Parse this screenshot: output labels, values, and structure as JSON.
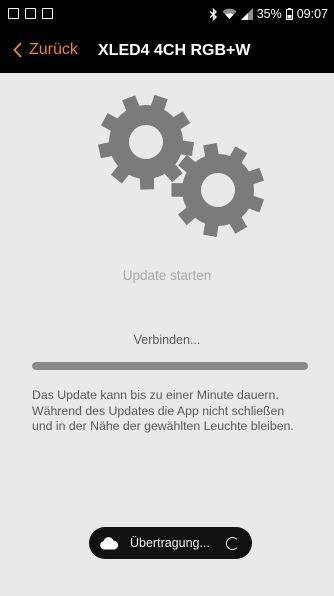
{
  "status_bar": {
    "battery": "35%",
    "time": "09:07"
  },
  "header": {
    "back_label": "Zurück",
    "title": "XLED4 4CH RGB+W"
  },
  "main": {
    "update_title": "Update starten",
    "status_text": "Verbinden...",
    "progress_fraction": 1.0,
    "info_lines": [
      "Das Update kann bis zu einer Minute dauern.",
      "Während des Updates die App nicht schließen",
      "und in der Nähe der gewählten Leuchte bleiben."
    ]
  },
  "toast": {
    "label": "Übertragung..."
  },
  "colors": {
    "accent": "#f08a1a",
    "gear": "#7b7b7b",
    "background": "#e9e9e9"
  }
}
